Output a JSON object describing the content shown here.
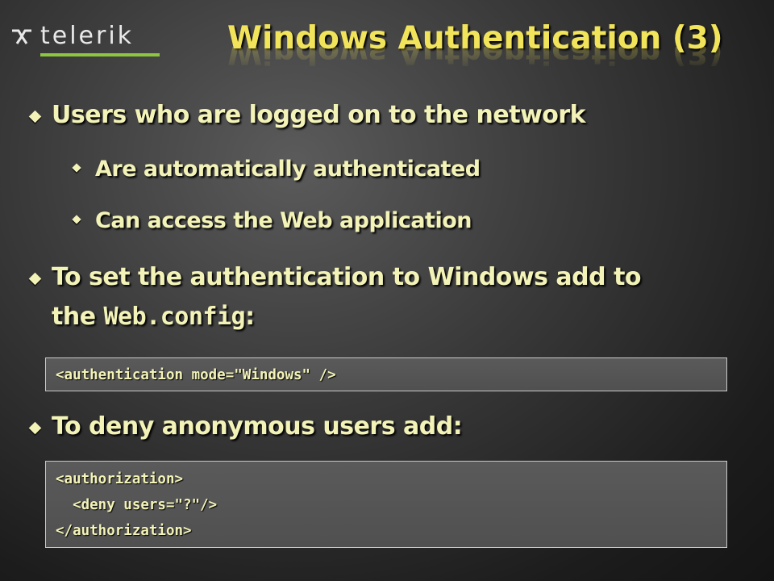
{
  "logo": {
    "text": "telerik",
    "accent_color": "#8dc63f"
  },
  "title": "Windows Authentication (3)",
  "bullets": [
    {
      "text": "Users who are logged on to the network",
      "sub": [
        "Are automatically authenticated",
        "Can access the Web application"
      ]
    },
    {
      "text_line1": "To set the authentication to Windows add to",
      "text_line2_prefix": "the ",
      "text_line2_code": "Web.config",
      "text_line2_suffix": ":"
    },
    {
      "text": "To deny anonymous users add:"
    }
  ],
  "code_blocks": [
    {
      "lines": [
        "<authentication mode=\"Windows\" />"
      ]
    },
    {
      "lines": [
        "<authorization>",
        "  <deny users=\"?\"/>",
        "</authorization>"
      ]
    }
  ],
  "colors": {
    "title": "#f2e45a",
    "body_text": "#f3f3b8",
    "background": "#2a2a2a"
  }
}
